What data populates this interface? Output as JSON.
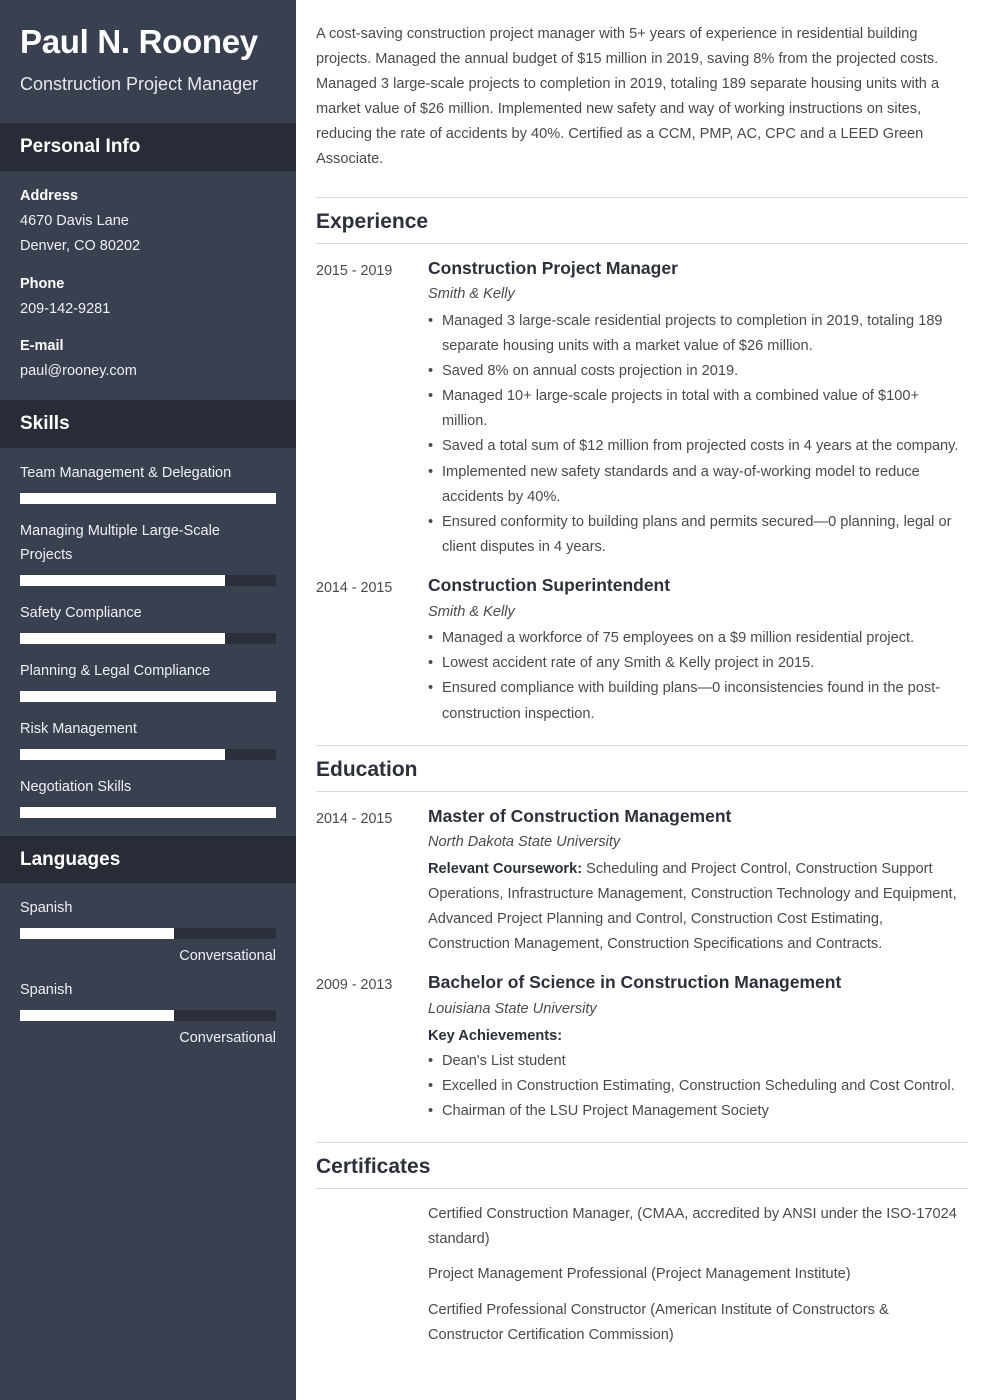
{
  "sidebar": {
    "full_name": "Paul N. Rooney",
    "job_title": "Construction Project Manager",
    "personal_info": {
      "heading": "Personal Info",
      "groups": [
        {
          "label": "Address",
          "lines": [
            "4670 Davis Lane",
            "Denver, CO 80202"
          ]
        },
        {
          "label": "Phone",
          "lines": [
            "209-142-9281"
          ]
        },
        {
          "label": "E-mail",
          "lines": [
            "paul@rooney.com"
          ]
        }
      ]
    },
    "skills": {
      "heading": "Skills",
      "items": [
        {
          "name": "Team Management & Delegation",
          "level": 100
        },
        {
          "name": "Managing Multiple Large-Scale Projects",
          "level": 80
        },
        {
          "name": "Safety Compliance",
          "level": 80
        },
        {
          "name": "Planning & Legal Compliance",
          "level": 100
        },
        {
          "name": "Risk Management",
          "level": 80
        },
        {
          "name": "Negotiation Skills",
          "level": 100
        }
      ]
    },
    "languages": {
      "heading": "Languages",
      "items": [
        {
          "name": "Spanish",
          "level": 60,
          "proficiency": "Conversational"
        },
        {
          "name": "Spanish",
          "level": 60,
          "proficiency": "Conversational"
        }
      ]
    }
  },
  "main": {
    "summary": "A cost-saving construction project manager with 5+ years of experience in residential building projects. Managed the annual budget of $15 million in 2019, saving 8% from the projected costs. Managed 3 large-scale projects to completion in 2019, totaling 189 separate housing units with a market value of $26 million. Implemented new safety and way of working instructions on sites, reducing the rate of accidents by 40%. Certified as a CCM, PMP, AC, CPC and a LEED Green Associate.",
    "experience": {
      "heading": "Experience",
      "entries": [
        {
          "date": "2015 - 2019",
          "title": "Construction Project Manager",
          "subtitle": "Smith & Kelly",
          "bullets": [
            "Managed 3 large-scale residential projects to completion in 2019, totaling 189 separate housing units with a market value of $26 million.",
            "Saved 8% on annual costs projection in 2019.",
            "Managed 10+ large-scale projects in total with a combined value of $100+ million.",
            "Saved a total sum of $12 million from projected costs in 4 years at the company.",
            "Implemented new safety standards and a way-of-working model to reduce accidents by 40%.",
            "Ensured conformity to building plans and permits secured—0 planning, legal or client disputes in 4 years."
          ]
        },
        {
          "date": "2014 - 2015",
          "title": "Construction Superintendent",
          "subtitle": "Smith & Kelly",
          "bullets": [
            "Managed a workforce of 75 employees on a $9 million residential project.",
            "Lowest accident rate of any Smith & Kelly project in 2015.",
            "Ensured compliance with building plans—0 inconsistencies found in the post-construction inspection."
          ]
        }
      ]
    },
    "education": {
      "heading": "Education",
      "entries": [
        {
          "date": "2014 - 2015",
          "title": "Master of Construction Management",
          "subtitle": "North Dakota State University",
          "note_label": "Relevant Coursework:",
          "note_text": " Scheduling and Project Control, Construction Support Operations, Infrastructure Management, Construction Technology and Equipment, Advanced Project Planning and Control, Construction Cost Estimating, Construction Management, Construction Specifications and Contracts.",
          "bullets": []
        },
        {
          "date": "2009 - 2013",
          "title": "Bachelor of Science in Construction Management",
          "subtitle": "Louisiana State University",
          "note_label": "Key Achievements:",
          "note_text": "",
          "bullets": [
            "Dean's List student",
            "Excelled in Construction Estimating, Construction Scheduling and Cost Control.",
            "Chairman of the LSU Project Management Society"
          ]
        }
      ]
    },
    "certificates": {
      "heading": "Certificates",
      "items": [
        "Certified Construction Manager, (CMAA, accredited by ANSI under the ISO-17024 standard)",
        "Project Management Professional (Project Management Institute)",
        "Certified Professional Constructor (American Institute of Constructors & Constructor Certification Commission)"
      ]
    }
  },
  "colors": {
    "sidebar_bg": "#394150",
    "sidebar_header_bg": "#272c37",
    "bar_fill": "#ffffff",
    "bar_track": "#2a2f3a",
    "heading_text": "#2b303b",
    "body_text": "#4a4a4a",
    "rule": "#d9d9d9"
  }
}
